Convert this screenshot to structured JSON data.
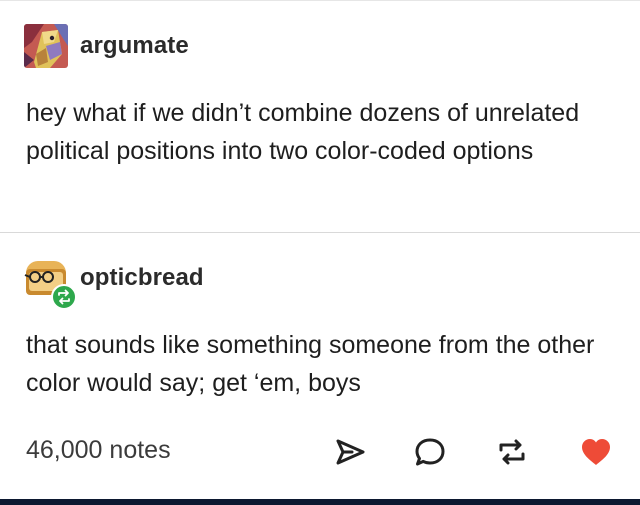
{
  "posts": [
    {
      "username": "argumate",
      "avatar_icon": "argumate-avatar-icon",
      "text": "hey what if we didn’t combine dozens of unrelated political positions into two color-coded options"
    },
    {
      "username": "opticbread",
      "avatar_icon": "opticbread-avatar-icon",
      "badge_icon": "reblog-badge-icon",
      "text": "that sounds like something someone from the other color would say; get ‘em, boys"
    }
  ],
  "footer": {
    "notes": "46,000 notes",
    "actions": [
      {
        "name": "share",
        "icon": "send-icon"
      },
      {
        "name": "reply",
        "icon": "reply-bubble-icon"
      },
      {
        "name": "reblog",
        "icon": "reblog-icon"
      },
      {
        "name": "like",
        "icon": "heart-icon",
        "color": "#ee4b37"
      }
    ]
  },
  "colors": {
    "divider": "#d9d9d9",
    "reblog_badge": "#2ea84c",
    "like_heart": "#ee4b37",
    "bottom_bar": "#0c1830"
  }
}
